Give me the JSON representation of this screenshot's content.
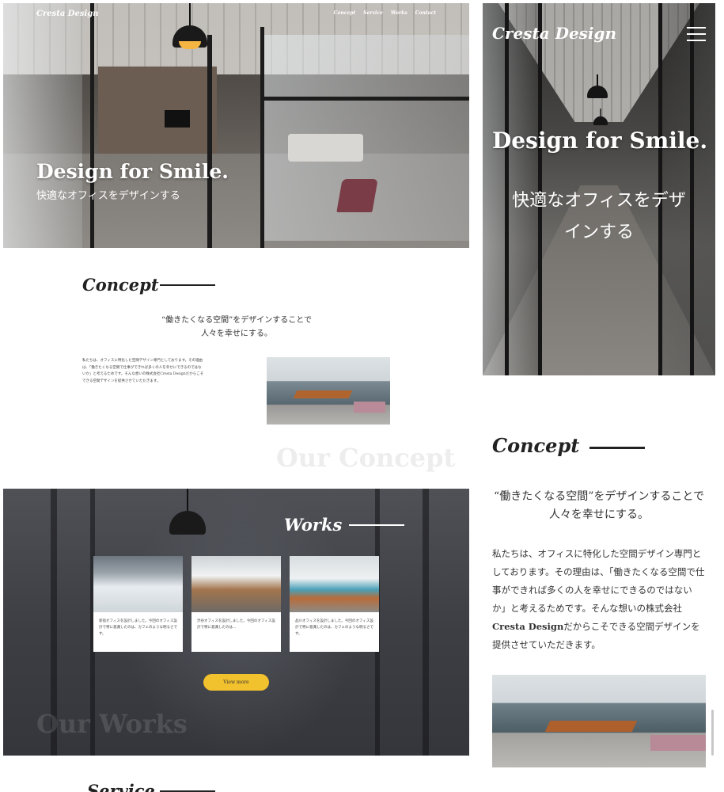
{
  "desktop": {
    "logo": "Cresta Design",
    "nav": [
      "Concept",
      "Service",
      "Works",
      "Contact"
    ],
    "hero": {
      "title": "Design for Smile.",
      "subtitle": "快適なオフィスをデザインする"
    },
    "concept": {
      "heading": "Concept",
      "lead_line1": "“働きたくなる空間”をデザインすることで",
      "lead_line2": "人々を幸せにする。",
      "body": "私たちは、オフィスに特化した空間デザイン専門としております。その理由は、「働きたくなる空間で仕事ができれば多くの人を幸せにできるのではないか」と考えるためです。そんな想いの株式会社Cresta Designだからこそできる空間デザインを提供させていただきます。",
      "watermark": "Our Concept"
    },
    "works": {
      "heading": "Works",
      "cards": [
        {
          "text": "新宿オフィスを設計しました。今回のオフィス設計で特に意識したのは、カフェのような明るさです。"
        },
        {
          "text": "渋谷オフィスを設計しました。今回のオフィス設計で特に意識したのは…"
        },
        {
          "text": "品川オフィスを設計しました。今回のオフィス設計で特に意識したのは、カフェのような明るさです。"
        }
      ],
      "button": "View more",
      "watermark": "Our Works"
    },
    "service": {
      "heading": "Service"
    }
  },
  "mobile": {
    "logo": "Cresta Design",
    "menu_icon": "hamburger-icon",
    "hero": {
      "title": "Design for Smile.",
      "subtitle": "快適なオフィスをデザインする"
    },
    "concept": {
      "heading": "Concept",
      "lead": "“働きたくなる空間”をデザインすることで 人々を幸せにする。",
      "body_pre": "私たちは、オフィスに特化した空間デザイン専門としております。その理由は、「働きたくなる空間で仕事ができれば多くの人を幸せにできるのではないか」と考えるためです。そんな想いの株式会社",
      "body_brand": "Cresta Design",
      "body_post": "だからこそできる空間デザインを提供させていただきます。"
    }
  },
  "colors": {
    "accent_button": "#f2c12e",
    "heading_text": "#222222",
    "watermark": "#ededed"
  }
}
